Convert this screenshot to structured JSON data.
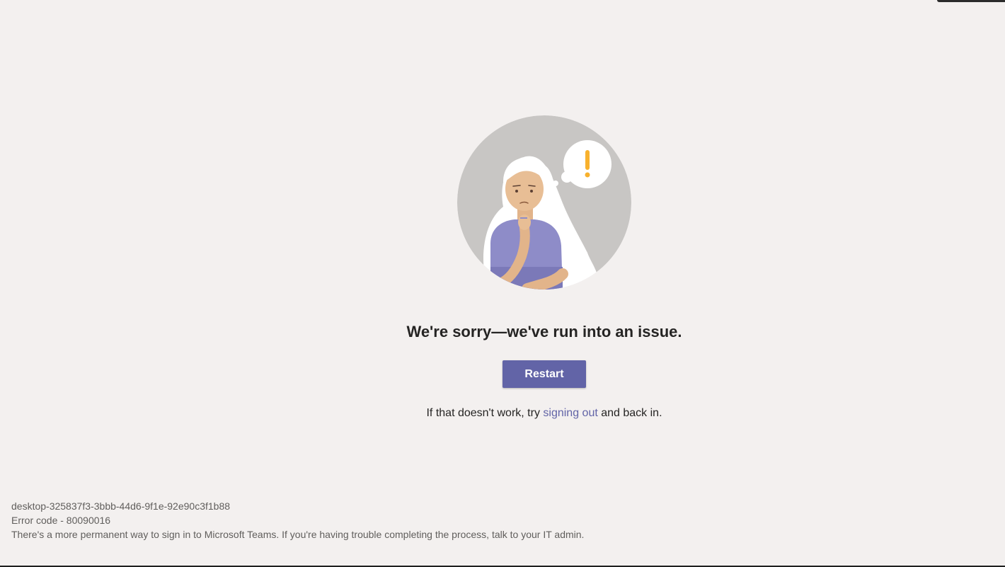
{
  "message": {
    "title": "We're sorry—we've run into an issue.",
    "restart_label": "Restart",
    "hint_prefix": "If that doesn't work, try ",
    "hint_link": "signing out",
    "hint_suffix": " and back in."
  },
  "footer": {
    "session_id": "desktop-325837f3-3bbb-44d6-9f1e-92e90c3f1b88",
    "error_code": "Error code - 80090016",
    "note": "There's a more permanent way to sign in to Microsoft Teams. If you're having trouble completing the process, talk to your IT admin."
  },
  "colors": {
    "background": "#f3f0ef",
    "accent": "#6264a7",
    "alert": "#f8b12d"
  },
  "icons": {
    "illustration": "confused-person-illustration",
    "alert": "exclamation-icon"
  }
}
